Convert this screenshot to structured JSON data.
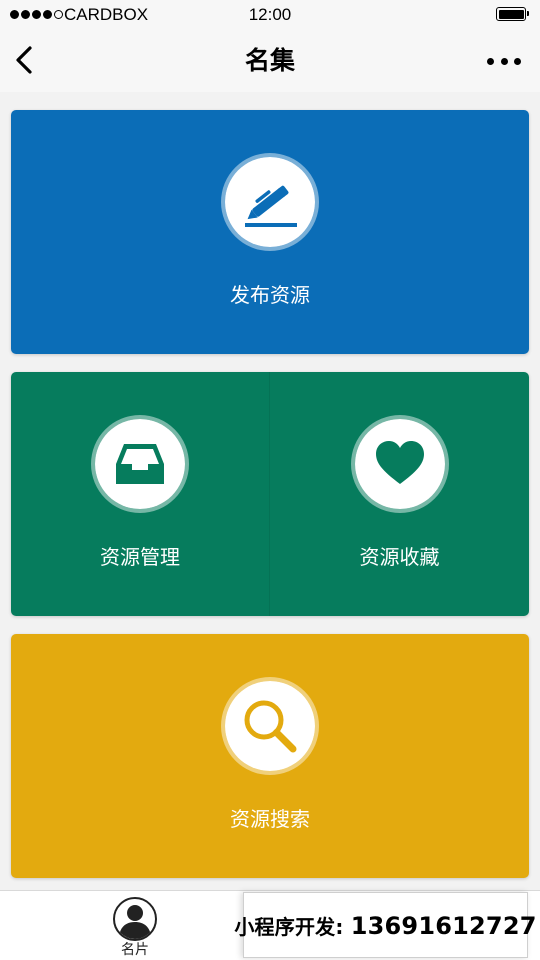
{
  "status_bar": {
    "carrier": "CARDBOX",
    "time": "12:00",
    "signal_bars_filled": 4,
    "signal_bars_total": 5
  },
  "nav": {
    "title": "名集",
    "back_icon": "chevron-left-icon",
    "more_icon": "ellipsis-icon"
  },
  "tiles": {
    "publish": {
      "label": "发布资源",
      "icon": "pen-icon",
      "color": "#0b6db7"
    },
    "manage": {
      "label": "资源管理",
      "icon": "inbox-tray-icon",
      "color": "#067c5d"
    },
    "favorites": {
      "label": "资源收藏",
      "icon": "heart-icon",
      "color": "#067c5d"
    },
    "search": {
      "label": "资源搜索",
      "icon": "magnifier-icon",
      "color": "#e3aa0f"
    }
  },
  "tab_bar": {
    "items": [
      {
        "label": "名片",
        "icon": "person-avatar-icon"
      }
    ]
  },
  "promo": {
    "prefix": "小程序开发:",
    "phone": "13691612727"
  }
}
